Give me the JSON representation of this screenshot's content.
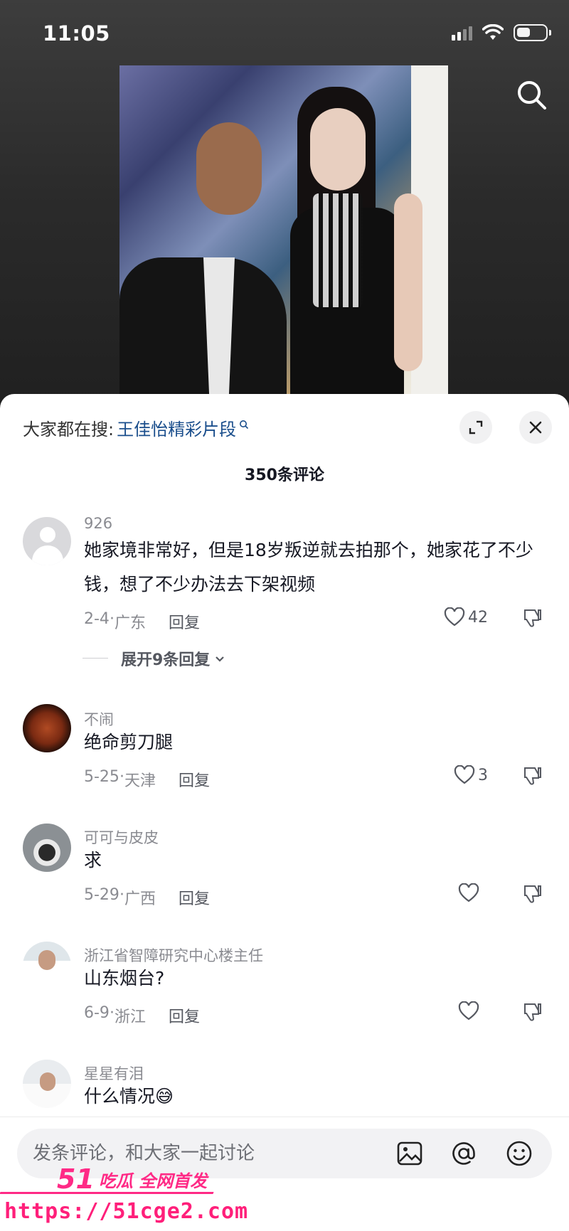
{
  "status": {
    "time": "11:05"
  },
  "sheet": {
    "hot_search_prefix": "大家都在搜:",
    "hot_search_term": "王佳怡精彩片段",
    "comment_count": "350条评论"
  },
  "comments": [
    {
      "name": "926",
      "text": "她家境非常好，但是18岁叛逆就去拍那个，她家花了不少钱，想了不少办法去下架视频",
      "date": "2-4",
      "location": "广东",
      "reply": "回复",
      "likes": "42",
      "expand": "展开9条回复"
    },
    {
      "name": "不闹",
      "text": "绝命剪刀腿",
      "date": "5-25",
      "location": "天津",
      "reply": "回复",
      "likes": "3"
    },
    {
      "name": "可可与皮皮",
      "text": "求",
      "date": "5-29",
      "location": "广西",
      "reply": "回复",
      "likes": ""
    },
    {
      "name": "浙江省智障研究中心楼主任",
      "text": "山东烟台?",
      "date": "6-9",
      "location": "浙江",
      "reply": "回复",
      "likes": ""
    },
    {
      "name": "星星有泪",
      "text": "什么情况😅"
    }
  ],
  "input": {
    "placeholder": "发条评论，和大家一起讨论"
  },
  "watermark": {
    "brand": "51",
    "tag": "吃瓜 全网首发",
    "url": "https://51cge2.com"
  },
  "colors": {
    "accent_link": "#1a4e8c",
    "watermark": "#ff2a86"
  }
}
